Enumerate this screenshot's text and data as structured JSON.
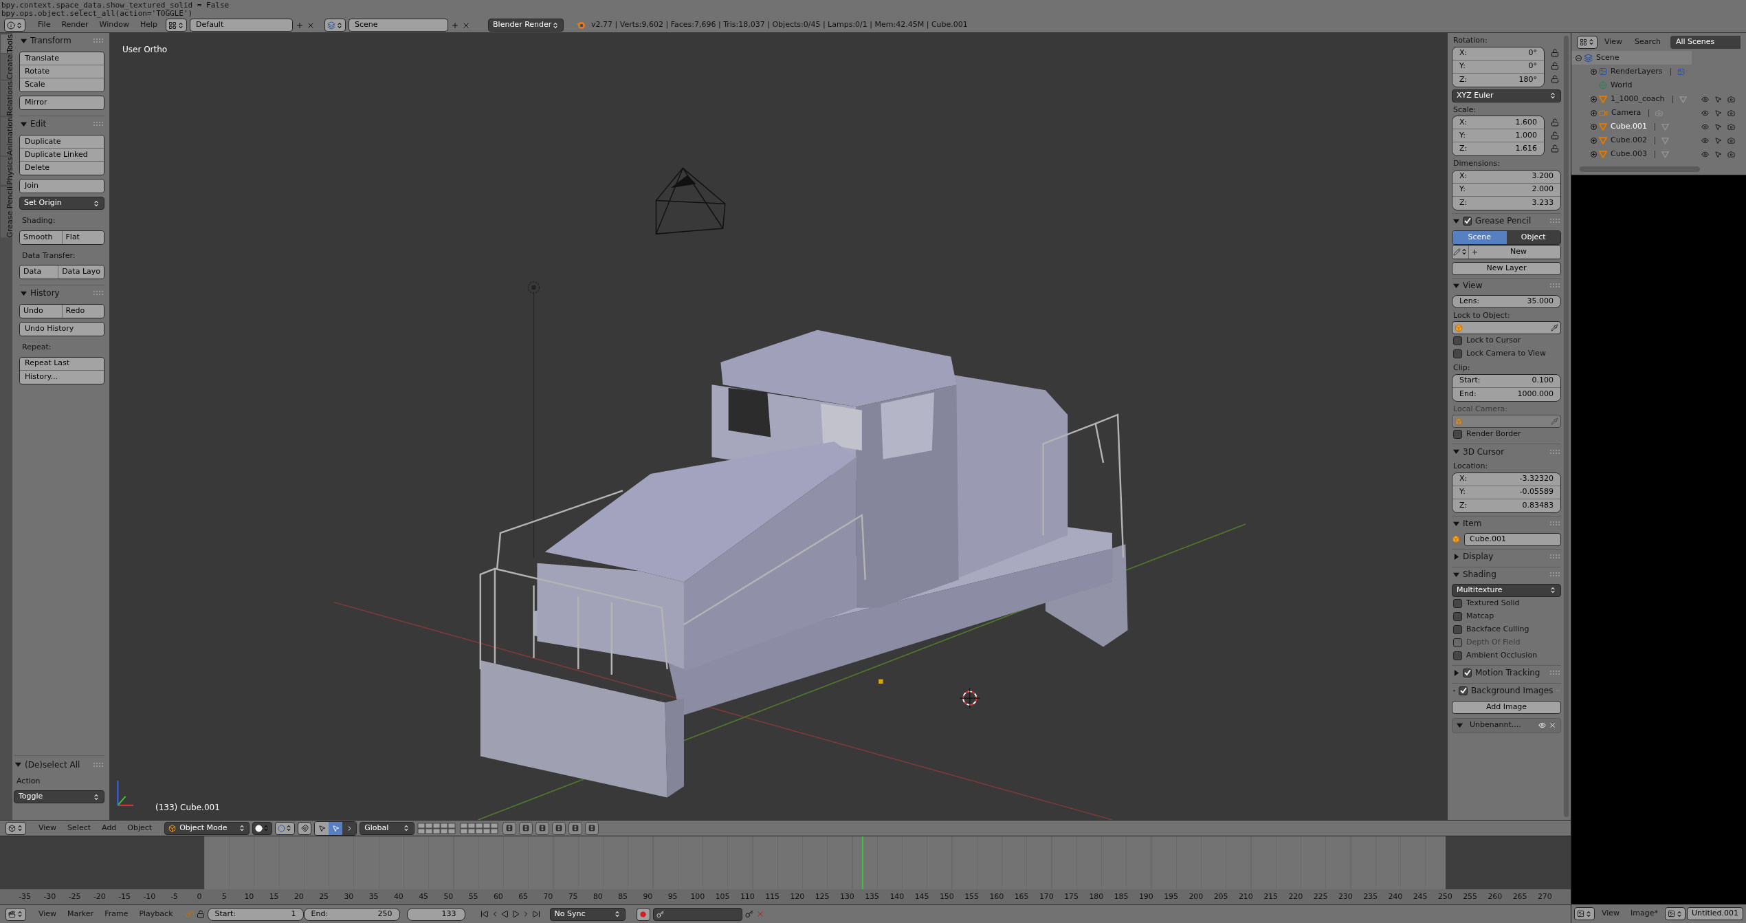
{
  "console_lines": [
    "bpy.context.space_data.show_textured_solid = False",
    "bpy.ops.object.select_all(action='TOGGLE')"
  ],
  "info_header": {
    "menus": [
      "File",
      "Render",
      "Window",
      "Help"
    ],
    "screen_layout": "Default",
    "scene": "Scene",
    "render_engine": "Blender Render",
    "stats": "v2.77 | Verts:9,602 | Faces:7,696 | Tris:18,037 | Objects:0/45 | Lamps:0/1 | Mem:42.45M | Cube.001"
  },
  "tool_tabs": [
    {
      "label": "Tools",
      "selected": true
    },
    {
      "label": "Create",
      "selected": false
    },
    {
      "label": "Relations",
      "selected": false
    },
    {
      "label": "Animation",
      "selected": false
    },
    {
      "label": "Physics",
      "selected": false
    },
    {
      "label": "Grease Pencil",
      "selected": false
    }
  ],
  "tool_panels": [
    {
      "title": "Transform",
      "expanded": true,
      "rows": [
        {
          "kind": "stack",
          "buttons": [
            "Translate",
            "Rotate",
            "Scale"
          ]
        },
        {
          "kind": "stack",
          "buttons": [
            "Mirror"
          ]
        }
      ]
    },
    {
      "title": "Edit",
      "expanded": true,
      "rows": [
        {
          "kind": "stack",
          "buttons": [
            "Duplicate",
            "Duplicate Linked",
            "Delete"
          ]
        },
        {
          "kind": "stack",
          "buttons": [
            "Join"
          ]
        },
        {
          "kind": "dropdown",
          "value": "Set Origin"
        },
        {
          "kind": "label",
          "text": "Shading:"
        },
        {
          "kind": "pair",
          "buttons": [
            "Smooth",
            "Flat"
          ]
        },
        {
          "kind": "label",
          "text": "Data Transfer:"
        },
        {
          "kind": "pair",
          "buttons": [
            "Data",
            "Data Layo"
          ]
        }
      ]
    },
    {
      "title": "History",
      "expanded": true,
      "rows": [
        {
          "kind": "pair",
          "buttons": [
            "Undo",
            "Redo"
          ]
        },
        {
          "kind": "stack",
          "buttons": [
            "Undo History"
          ]
        },
        {
          "kind": "label",
          "text": "Repeat:"
        },
        {
          "kind": "stack",
          "buttons": [
            "Repeat Last",
            "History..."
          ]
        }
      ]
    }
  ],
  "operator_panel": {
    "title": "(De)select All",
    "expanded": true,
    "label": "Action",
    "value": "Toggle"
  },
  "viewport": {
    "view_name": "User Ortho",
    "object_info": "(133) Cube.001"
  },
  "properties": [
    {
      "kind": "label",
      "text": "Rotation:"
    },
    {
      "kind": "vector",
      "locks": true,
      "fields": [
        {
          "label": "X:",
          "value": "0°"
        },
        {
          "label": "Y:",
          "value": "0°"
        },
        {
          "label": "Z:",
          "value": "180°"
        }
      ]
    },
    {
      "kind": "dropdown",
      "value": "XYZ Euler"
    },
    {
      "kind": "label",
      "text": "Scale:"
    },
    {
      "kind": "vector",
      "locks": true,
      "fields": [
        {
          "label": "X:",
          "value": "1.600"
        },
        {
          "label": "Y:",
          "value": "1.000"
        },
        {
          "label": "Z:",
          "value": "1.616"
        }
      ]
    },
    {
      "kind": "label",
      "text": "Dimensions:"
    },
    {
      "kind": "vector",
      "locks": false,
      "fields": [
        {
          "label": "X:",
          "value": "3.200"
        },
        {
          "label": "Y:",
          "value": "2.000"
        },
        {
          "label": "Z:",
          "value": "3.233"
        }
      ]
    },
    {
      "kind": "header",
      "title": "Grease Pencil",
      "expanded": true,
      "checked": true
    },
    {
      "kind": "segmented",
      "options": [
        {
          "label": "Scene",
          "selected": true
        },
        {
          "label": "Object",
          "selected": false
        }
      ]
    },
    {
      "kind": "gp_new",
      "label": "New"
    },
    {
      "kind": "button",
      "label": "New Layer"
    },
    {
      "kind": "header",
      "title": "View",
      "expanded": true
    },
    {
      "kind": "field",
      "label": "Lens:",
      "value": "35.000"
    },
    {
      "kind": "label",
      "text": "Lock to Object:"
    },
    {
      "kind": "object_field",
      "disabled": false
    },
    {
      "kind": "checkbox",
      "label": "Lock to Cursor",
      "checked": false,
      "disabled": false
    },
    {
      "kind": "checkbox",
      "label": "Lock Camera to View",
      "checked": false,
      "disabled": false
    },
    {
      "kind": "label",
      "text": "Clip:"
    },
    {
      "kind": "vector",
      "locks": false,
      "fields": [
        {
          "label": "Start:",
          "value": "0.100"
        },
        {
          "label": "End:",
          "value": "1000.000"
        }
      ]
    },
    {
      "kind": "label",
      "text": "Local Camera:",
      "disabled": true
    },
    {
      "kind": "object_field",
      "disabled": true
    },
    {
      "kind": "checkbox",
      "label": "Render Border",
      "checked": false,
      "disabled": false
    },
    {
      "kind": "header",
      "title": "3D Cursor",
      "expanded": true
    },
    {
      "kind": "label",
      "text": "Location:"
    },
    {
      "kind": "vector",
      "locks": false,
      "fields": [
        {
          "label": "X:",
          "value": "-3.32320"
        },
        {
          "label": "Y:",
          "value": "-0.05589"
        },
        {
          "label": "Z:",
          "value": "0.83483"
        }
      ]
    },
    {
      "kind": "header",
      "title": "Item",
      "expanded": true
    },
    {
      "kind": "name_field",
      "value": "Cube.001"
    },
    {
      "kind": "header",
      "title": "Display",
      "expanded": false
    },
    {
      "kind": "header",
      "title": "Shading",
      "expanded": true
    },
    {
      "kind": "dropdown",
      "value": "Multitexture"
    },
    {
      "kind": "checkbox",
      "label": "Textured Solid",
      "checked": false,
      "disabled": false
    },
    {
      "kind": "checkbox",
      "label": "Matcap",
      "checked": false,
      "disabled": false
    },
    {
      "kind": "checkbox",
      "label": "Backface Culling",
      "checked": false,
      "disabled": false
    },
    {
      "kind": "checkbox",
      "label": "Depth Of Field",
      "checked": false,
      "disabled": true
    },
    {
      "kind": "checkbox",
      "label": "Ambient Occlusion",
      "checked": false,
      "disabled": false
    },
    {
      "kind": "header",
      "title": "Motion Tracking",
      "expanded": false,
      "checked": true
    },
    {
      "kind": "header",
      "title": "Background Images",
      "expanded": true,
      "checked": true
    },
    {
      "kind": "button",
      "label": "Add Image"
    },
    {
      "kind": "bg_item",
      "label": "Unbenannt....",
      "expanded": true
    }
  ],
  "outliner": {
    "menus": [
      "View",
      "Search"
    ],
    "filter": "All Scenes",
    "tree": [
      {
        "name": "Scene",
        "kind": "scene",
        "expanded": true,
        "selected": false,
        "children": [
          {
            "name": "RenderLayers",
            "kind": "renderlayers",
            "expanded": false,
            "selected": false
          },
          {
            "name": "World",
            "kind": "world",
            "selected": false
          },
          {
            "name": "1_1000_coach",
            "kind": "mesh",
            "expanded": false,
            "selected": false
          },
          {
            "name": "Camera",
            "kind": "camera",
            "expanded": false,
            "selected": false
          },
          {
            "name": "Cube.001",
            "kind": "mesh",
            "expanded": false,
            "selected": true
          },
          {
            "name": "Cube.002",
            "kind": "mesh",
            "expanded": false,
            "selected": false
          },
          {
            "name": "Cube.003",
            "kind": "mesh",
            "expanded": false,
            "selected": false
          }
        ]
      }
    ]
  },
  "view3d_header": {
    "menus": [
      "View",
      "Select",
      "Add",
      "Object"
    ],
    "mode": "Object Mode",
    "orientation": "Global"
  },
  "timeline": {
    "ruler_labels": [
      "-35",
      "-30",
      "-25",
      "-20",
      "-15",
      "-10",
      "-5",
      "0",
      "5",
      "10",
      "15",
      "20",
      "25",
      "30",
      "35",
      "40",
      "45",
      "50",
      "55",
      "60",
      "65",
      "70",
      "75",
      "80",
      "85",
      "90",
      "95",
      "100",
      "105",
      "110",
      "115",
      "120",
      "125",
      "130",
      "135",
      "140",
      "145",
      "150",
      "155",
      "160",
      "165",
      "170",
      "175",
      "180",
      "185",
      "190",
      "195",
      "200",
      "205",
      "210",
      "215",
      "220",
      "225",
      "230",
      "235",
      "240",
      "245",
      "250",
      "255",
      "260",
      "265",
      "270"
    ],
    "menus": [
      "View",
      "Marker",
      "Frame",
      "Playback"
    ],
    "start_label": "Start:",
    "start": "1",
    "end_label": "End:",
    "end": "250",
    "current_frame": "133",
    "sync": "No Sync"
  },
  "image_editor": {
    "menus": [
      "View",
      "Image*"
    ],
    "image_name": "Untitled.001"
  }
}
